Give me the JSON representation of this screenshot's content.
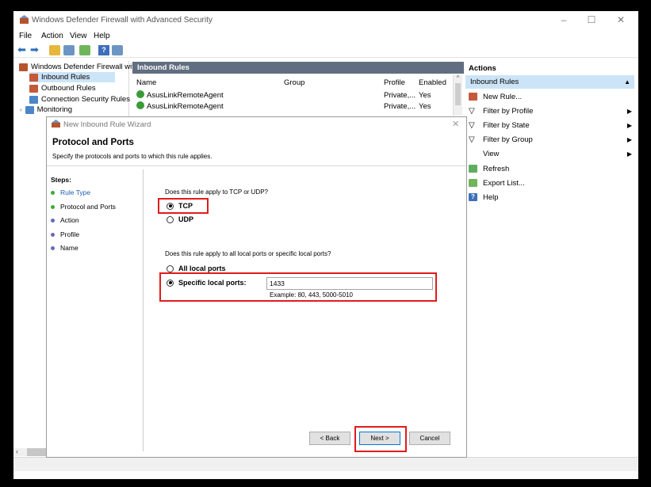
{
  "window": {
    "title": "Windows Defender Firewall with Advanced Security"
  },
  "menu": {
    "items": [
      "File",
      "Action",
      "View",
      "Help"
    ]
  },
  "tree": {
    "root": "Windows Defender Firewall with",
    "items": [
      "Inbound Rules",
      "Outbound Rules",
      "Connection Security Rules",
      "Monitoring"
    ]
  },
  "center": {
    "header": "Inbound Rules",
    "columns": {
      "name": "Name",
      "group": "Group",
      "profile": "Profile",
      "enabled": "Enabled"
    },
    "rows": [
      {
        "name": "AsusLinkRemoteAgent",
        "profile": "Private,...",
        "enabled": "Yes"
      },
      {
        "name": "AsusLinkRemoteAgent",
        "profile": "Private,...",
        "enabled": "Yes"
      }
    ]
  },
  "actions": {
    "header": "Actions",
    "section": "Inbound Rules",
    "items": [
      {
        "label": "New Rule...",
        "icon": "new-rule-icon",
        "submenu": false
      },
      {
        "label": "Filter by Profile",
        "icon": "filter-icon",
        "submenu": true
      },
      {
        "label": "Filter by State",
        "icon": "filter-icon",
        "submenu": true
      },
      {
        "label": "Filter by Group",
        "icon": "filter-icon",
        "submenu": true
      },
      {
        "label": "View",
        "icon": "",
        "submenu": true
      },
      {
        "label": "Refresh",
        "icon": "refresh-icon",
        "submenu": false
      },
      {
        "label": "Export List...",
        "icon": "export-icon",
        "submenu": false
      },
      {
        "label": "Help",
        "icon": "help-icon",
        "submenu": false
      }
    ]
  },
  "wizard": {
    "title": "New Inbound Rule Wizard",
    "heading": "Protocol and Ports",
    "subheading": "Specify the protocols and ports to which this rule applies.",
    "steps_label": "Steps:",
    "steps": [
      "Rule Type",
      "Protocol and Ports",
      "Action",
      "Profile",
      "Name"
    ],
    "current_step": "Protocol and Ports",
    "protocol_question": "Does this rule apply to TCP or UDP?",
    "protocol_options": [
      "TCP",
      "UDP"
    ],
    "protocol_selected": "TCP",
    "ports_question": "Does this rule apply to all local ports or specific local ports?",
    "ports_all_label": "All local ports",
    "ports_specific_label": "Specific local ports:",
    "ports_selected": "Specific local ports:",
    "ports_value": "1433",
    "ports_example": "Example: 80, 443, 5000-5010",
    "back_label": "< Back",
    "next_label": "Next >",
    "cancel_label": "Cancel"
  },
  "colors": {
    "highlight": "#e21b1b",
    "header_bg": "#616d80",
    "selection": "#cce4f7",
    "done_step": "#3aaa3a",
    "pending_step": "#6a6ab8"
  }
}
